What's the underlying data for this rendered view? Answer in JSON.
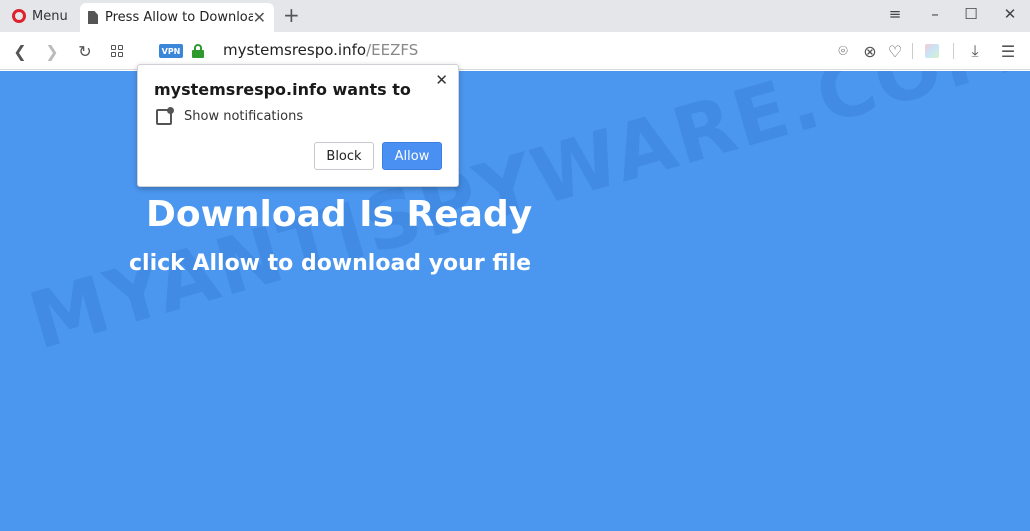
{
  "browser": {
    "menu_label": "Menu",
    "tab_title": "Press Allow to Download",
    "url_domain": "mystemsrespo.info",
    "url_path": "/EEZFS",
    "vpn_badge": "VPN"
  },
  "popup": {
    "title": "mystemsrespo.info wants to",
    "permission": "Show notifications",
    "block_label": "Block",
    "allow_label": "Allow"
  },
  "page": {
    "headline": "Download Is Ready",
    "subline": "click Allow to download your file",
    "watermark": "MYANTISPYWARE.COM",
    "background_color": "#4b97f0"
  }
}
